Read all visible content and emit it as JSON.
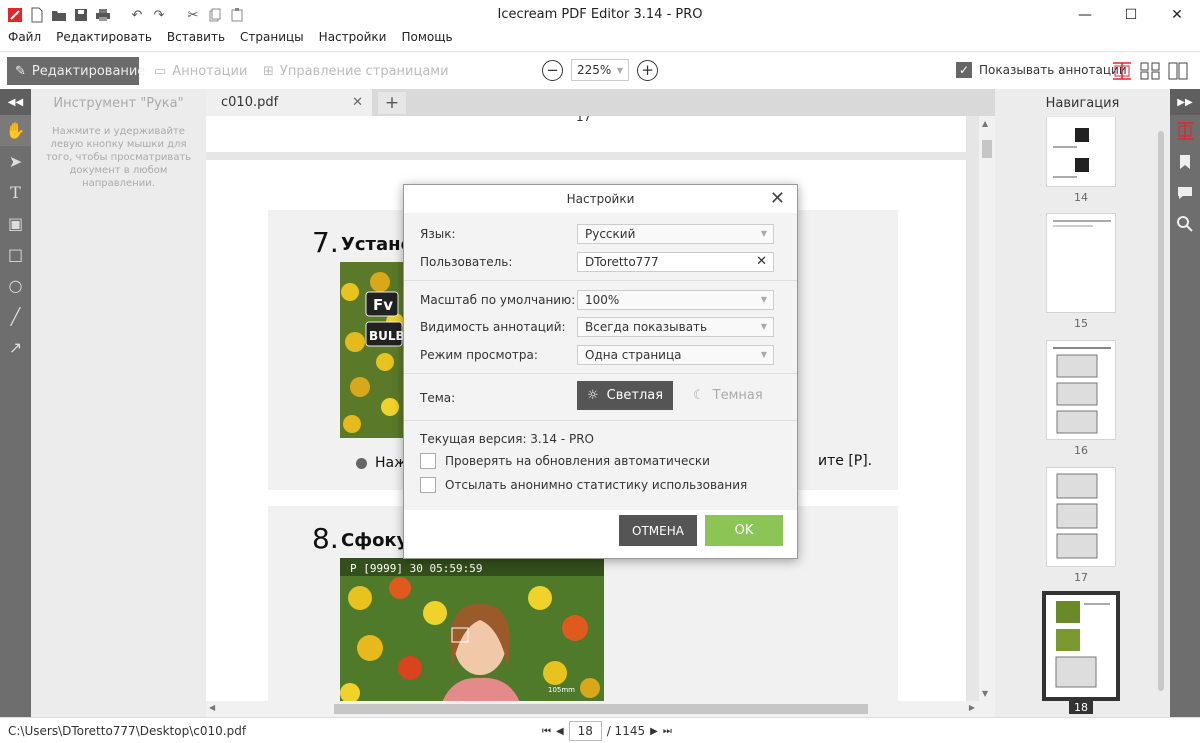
{
  "window": {
    "title": "Icecream PDF Editor 3.14 - PRO",
    "controls": [
      "minimize-icon",
      "maximize-icon",
      "close-icon"
    ]
  },
  "quick_access": [
    "app-logo-icon",
    "new-icon",
    "open-icon",
    "save-icon",
    "print-icon",
    "undo-icon",
    "redo-icon",
    "cut-icon",
    "copy-icon",
    "paste-icon"
  ],
  "menu": [
    "Файл",
    "Редактировать",
    "Вставить",
    "Страницы",
    "Настройки",
    "Помощь"
  ],
  "toolbar": {
    "edit_mode": "Редактирование",
    "annotations_mode": "Аннотации",
    "pages_mode": "Управление страницами",
    "zoom": "225%",
    "show_annotations": "Показывать аннотации",
    "show_annotations_checked": true
  },
  "left_panel": {
    "title": "Инструмент \"Рука\"",
    "description": "Нажмите и удерживайте левую кнопку мышки для того, чтобы просматривать документ в любом направлении."
  },
  "tabs": [
    {
      "label": "c010.pdf"
    }
  ],
  "document": {
    "prev_page_number": "17",
    "step7_num": "7.",
    "step7_text": "Устано",
    "step7_bullet": "Наж",
    "step7_tail": "ите [P].",
    "step8_num": "8.",
    "step8_text": "Сфоку",
    "camera_osd": "P  [9999] 30  05:59:59",
    "camera_focal": "105mm",
    "fv_label": "Fv",
    "bulb_label": "BULB"
  },
  "navigation": {
    "title": "Навигация",
    "thumbnails": [
      "14",
      "15",
      "16",
      "17",
      "18"
    ],
    "selected": "18"
  },
  "status": {
    "path": "C:\\Users\\DToretto777\\Desktop\\c010.pdf",
    "current_page": "18",
    "total_pages": "/ 1145"
  },
  "dialog": {
    "title": "Настройки",
    "language_label": "Язык:",
    "language_value": "Русский",
    "user_label": "Пользователь:",
    "user_value": "DToretto777",
    "scale_label": "Масштаб по умолчанию:",
    "scale_value": "100%",
    "visibility_label": "Видимость аннотаций:",
    "visibility_value": "Всегда показывать",
    "view_label": "Режим просмотра:",
    "view_value": "Одна страница",
    "theme_label": "Тема:",
    "theme_light": "Светлая",
    "theme_dark": "Темная",
    "version": "Текущая версия: 3.14 - PRO",
    "check_updates": "Проверять на обновления автоматически",
    "send_stats": "Отсылать анонимно статистику использования",
    "cancel": "ОТМЕНА",
    "ok": "OK"
  },
  "colors": {
    "accent_ok": "#8dc456",
    "dark_button": "#555555",
    "sidebar": "#6e6e6e",
    "logo_red": "#e0262b"
  }
}
